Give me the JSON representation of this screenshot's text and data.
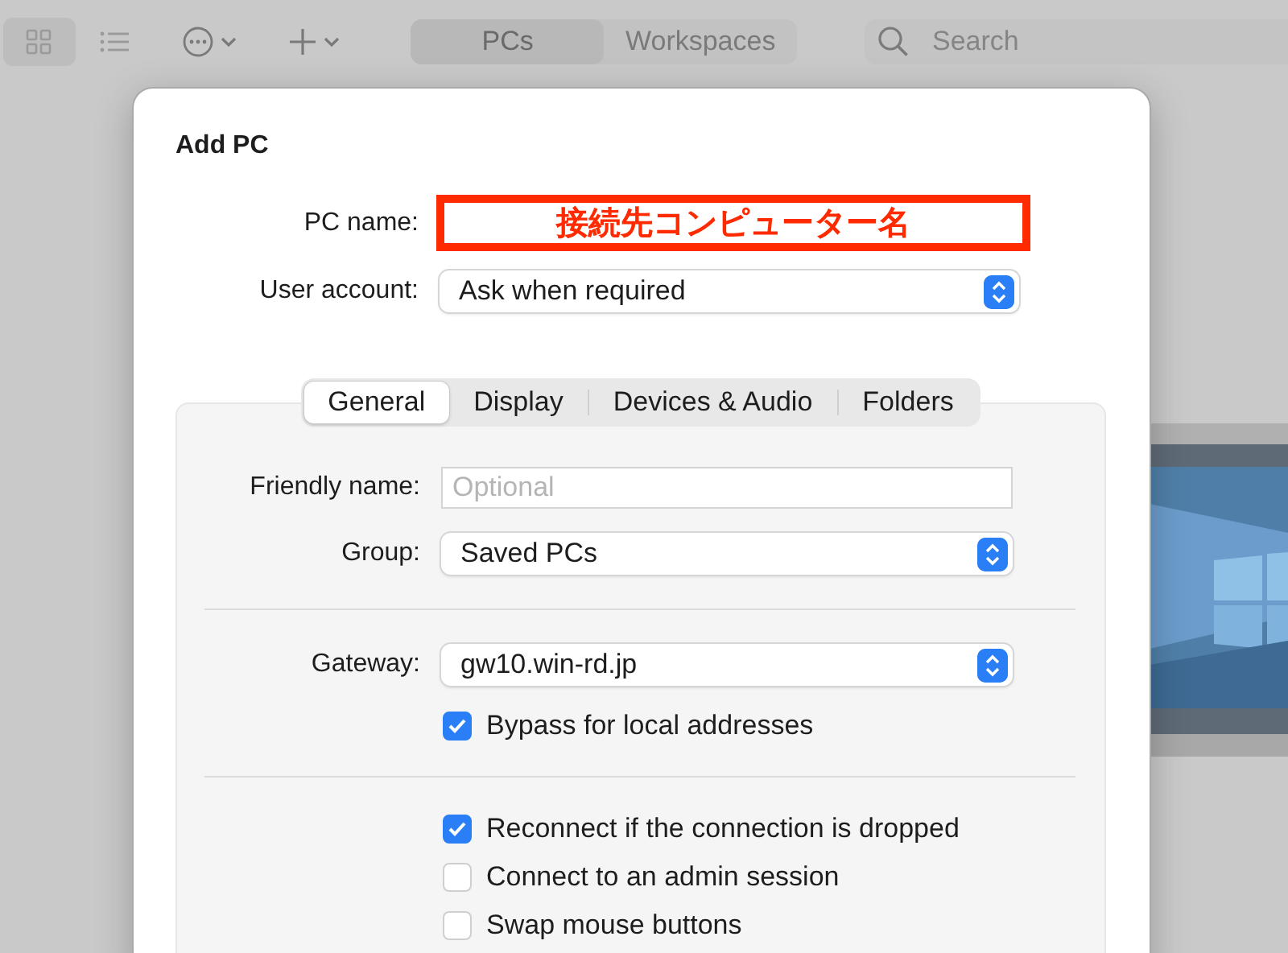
{
  "toolbar": {
    "view_buttons": [
      {
        "kind": "grid",
        "selected": true
      },
      {
        "kind": "list",
        "selected": false
      }
    ],
    "segments": [
      {
        "label": "PCs",
        "selected": true
      },
      {
        "label": "Workspaces",
        "selected": false
      }
    ],
    "search": {
      "placeholder": "Search"
    }
  },
  "dialog": {
    "title": "Add PC",
    "pc_name": {
      "label": "PC name:",
      "annotation": "接続先コンピューター名"
    },
    "user_account": {
      "label": "User account:",
      "value": "Ask when required"
    },
    "tabs": [
      {
        "label": "General",
        "selected": true
      },
      {
        "label": "Display",
        "selected": false
      },
      {
        "label": "Devices & Audio",
        "selected": false
      },
      {
        "label": "Folders",
        "selected": false
      }
    ],
    "friendly_name": {
      "label": "Friendly name:",
      "placeholder": "Optional"
    },
    "group": {
      "label": "Group:",
      "value": "Saved PCs"
    },
    "gateway": {
      "label": "Gateway:",
      "value": "gw10.win-rd.jp"
    },
    "gateway_options": [
      {
        "label": "Bypass for local addresses",
        "checked": true
      }
    ],
    "options": [
      {
        "label": "Reconnect if the connection is dropped",
        "checked": true
      },
      {
        "label": "Connect to an admin session",
        "checked": false
      },
      {
        "label": "Swap mouse buttons",
        "checked": false
      }
    ]
  }
}
